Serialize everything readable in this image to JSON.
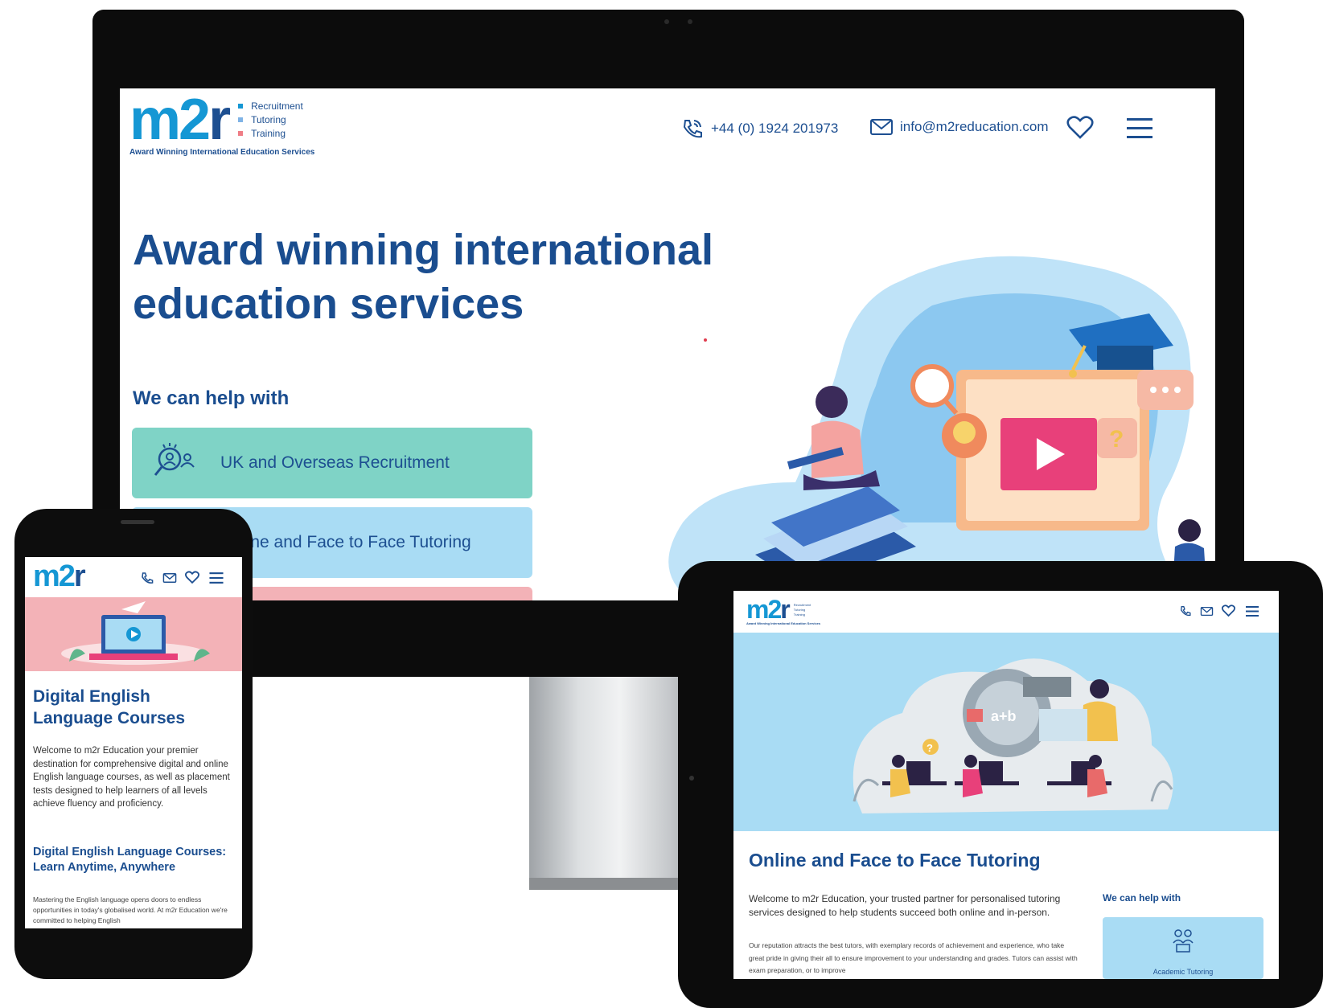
{
  "desktop": {
    "logo": {
      "text_m2": "m2",
      "text_r": "r",
      "items": [
        "Recruitment",
        "Tutoring",
        "Training"
      ],
      "tagline": "Award Winning International Education Services"
    },
    "header": {
      "phone": "+44 (0) 1924 201973",
      "email": "info@m2reducation.com"
    },
    "hero_title_line1": "Award winning international",
    "hero_title_line2": "education services",
    "help_title": "We can help with",
    "help_items": [
      {
        "label": "UK and Overseas Recruitment",
        "color": "#7fd3c6",
        "icon": "recruitment-search-icon"
      },
      {
        "label": "Online and Face to Face Tutoring",
        "color": "#a9dcf4",
        "icon": "tutoring-icon"
      },
      {
        "label": "",
        "color": "#f3b2b7",
        "icon": ""
      }
    ]
  },
  "phone": {
    "logo_m2": "m2",
    "logo_r": "r",
    "title": "Digital English Language Courses",
    "intro": "Welcome to m2r Education your premier destination for comprehensive digital and online English language courses, as well as placement tests designed to help learners of all levels achieve fluency and proficiency.",
    "subtitle": "Digital English Language Courses: Learn Anytime, Anywhere",
    "body": "Mastering the English language opens doors to endless opportunities in today's globalised world. At m2r Education we're committed to helping English"
  },
  "tablet": {
    "logo_m2": "m2",
    "logo_r": "r",
    "logo_items": [
      "Recruitment",
      "Tutoring",
      "Training"
    ],
    "logo_tagline": "Award Winning International Education Services",
    "title": "Online and Face to Face Tutoring",
    "intro": "Welcome to m2r Education, your trusted partner for personalised tutoring services designed to help students succeed both online and in-person.",
    "body": "Our reputation attracts the best tutors, with exemplary records of achievement and experience, who take great pride in giving their all to ensure improvement to your understanding and grades. Tutors can assist with exam preparation, or to improve",
    "help_title": "We can help with",
    "card_label": "Academic Tutoring"
  },
  "colors": {
    "brand_blue": "#1597d4",
    "navy": "#1a4d8f",
    "teal": "#7fd3c6",
    "light_blue": "#a9dcf4",
    "pink": "#f3b2b7"
  }
}
